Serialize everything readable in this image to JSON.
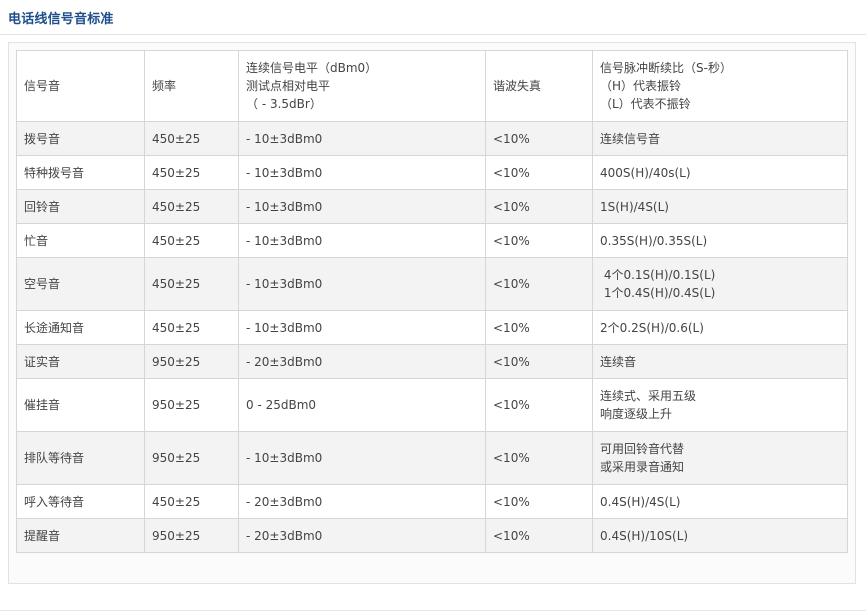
{
  "page": {
    "title": "电话线信号音标准"
  },
  "table": {
    "headers": [
      {
        "lines": [
          "信号音"
        ]
      },
      {
        "lines": [
          "频率"
        ]
      },
      {
        "lines": [
          "连续信号电平（dBm0）",
          "测试点相对电平",
          "（ - 3.5dBr）"
        ]
      },
      {
        "lines": [
          "谐波失真"
        ]
      },
      {
        "lines": [
          "信号脉冲断续比（S-秒）",
          "（H）代表振铃",
          "（L）代表不振铃"
        ]
      }
    ],
    "rows": [
      {
        "signal": "拨号音",
        "freq": "450±25",
        "level": "- 10±3dBm0",
        "distortion": "<10%",
        "ratio": [
          "连续信号音"
        ]
      },
      {
        "signal": "特种拨号音",
        "freq": "450±25",
        "level": "- 10±3dBm0",
        "distortion": "<10%",
        "ratio": [
          "400S(H)/40s(L)"
        ]
      },
      {
        "signal": "回铃音",
        "freq": "450±25",
        "level": "- 10±3dBm0",
        "distortion": "<10%",
        "ratio": [
          "1S(H)/4S(L)"
        ]
      },
      {
        "signal": "忙音",
        "freq": "450±25",
        "level": "- 10±3dBm0",
        "distortion": "<10%",
        "ratio": [
          "0.35S(H)/0.35S(L)"
        ]
      },
      {
        "signal": "空号音",
        "freq": "450±25",
        "level": "- 10±3dBm0",
        "distortion": "<10%",
        "ratio": [
          " 4个0.1S(H)/0.1S(L)",
          " 1个0.4S(H)/0.4S(L)"
        ]
      },
      {
        "signal": "长途通知音",
        "freq": "450±25",
        "level": "- 10±3dBm0",
        "distortion": "<10%",
        "ratio": [
          "2个0.2S(H)/0.6(L)"
        ]
      },
      {
        "signal": "证实音",
        "freq": "950±25",
        "level": "- 20±3dBm0",
        "distortion": "<10%",
        "ratio": [
          "连续音"
        ]
      },
      {
        "signal": "催挂音",
        "freq": "950±25",
        "level": "0 - 25dBm0",
        "distortion": "<10%",
        "ratio": [
          "连续式、采用五级",
          "响度逐级上升"
        ]
      },
      {
        "signal": "排队等待音",
        "freq": "950±25",
        "level": "- 10±3dBm0",
        "distortion": "<10%",
        "ratio": [
          "可用回铃音代替",
          "或采用录音通知"
        ]
      },
      {
        "signal": "呼入等待音",
        "freq": "450±25",
        "level": "- 20±3dBm0",
        "distortion": "<10%",
        "ratio": [
          "0.4S(H)/4S(L)"
        ]
      },
      {
        "signal": "提醒音",
        "freq": "950±25",
        "level": "- 20±3dBm0",
        "distortion": "<10%",
        "ratio": [
          "0.4S(H)/10S(L)"
        ]
      }
    ]
  }
}
